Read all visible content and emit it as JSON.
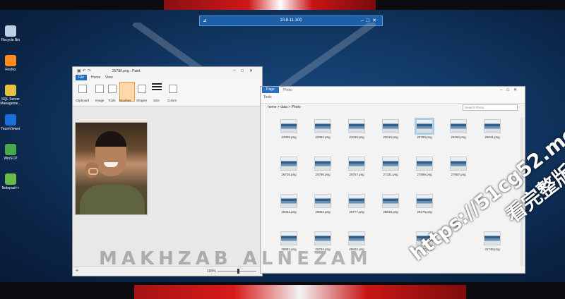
{
  "remote_session": {
    "ip": "10.8.11.100"
  },
  "desktop_icons": [
    {
      "label": "Recycle Bin",
      "icon": "recycle-bin-icon",
      "color": "#bcd0e6"
    },
    {
      "label": "Firefox",
      "icon": "firefox-icon",
      "color": "#ff8a1f"
    },
    {
      "label": "SQL Server Manageme...",
      "icon": "sql-server-icon",
      "color": "#e6c040"
    },
    {
      "label": "TeamViewer",
      "icon": "teamviewer-icon",
      "color": "#1a6fd8"
    },
    {
      "label": "WinSCP",
      "icon": "winscp-icon",
      "color": "#4aa84c"
    },
    {
      "label": "Notepad++",
      "icon": "notepadpp-icon",
      "color": "#6aba4a"
    }
  ],
  "paint": {
    "title": "25780.png - Paint",
    "tabs": {
      "file": "File",
      "home": "Home",
      "view": "View"
    },
    "ribbon": {
      "clipboard": "Clipboard",
      "image": "Image",
      "tools": "Tools",
      "brushes": "Brushes",
      "shapes": "Shapes",
      "size": "Size",
      "colors": "Colors"
    },
    "zoom": "100%"
  },
  "file_manager": {
    "tab_active": "Page",
    "tab_other": "Photo",
    "ribbon_label": "Tools",
    "breadcrumb": "home  >  data  >  Photo",
    "search_placeholder": "Search Photo",
    "files": [
      "22945.png",
      "22962.png",
      "23310.png",
      "23510.png",
      "25780.png",
      "26452.png",
      "25641.png",
      "26725.png",
      "26780.png",
      "26757.png",
      "27221.png",
      "27896.png",
      "27957.png",
      "",
      "29461.png",
      "28864.png",
      "28777.png",
      "28818.png",
      "29175.png",
      "",
      "",
      "29881.png",
      "29754.png",
      "29602.png",
      "",
      "30227.png",
      "",
      "31745.png"
    ],
    "selected": "25780.png"
  },
  "watermark": {
    "brand": "MAKHZAB ALNEZAM",
    "url": "https://51cg52.me",
    "cn": "看完整版"
  }
}
